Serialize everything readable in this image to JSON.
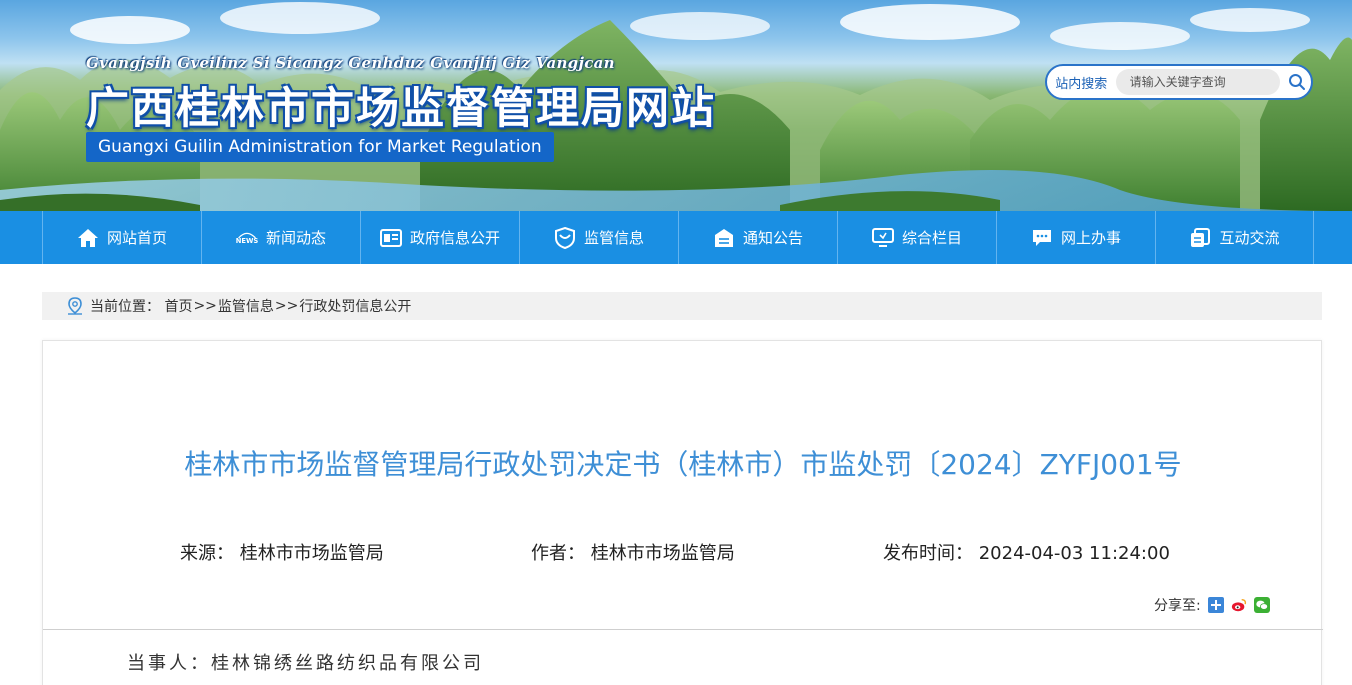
{
  "header": {
    "title_pinyin": "Gvangjsih Gveilinz Si Sicangz Genhduz Gvanjlij Giz Vangjcan",
    "title_cn": "广西桂林市市场监督管理局网站",
    "title_en": "Guangxi Guilin Administration for Market Regulation",
    "search": {
      "label": "站内搜索",
      "placeholder": "请输入关键字查询",
      "icon": "search-icon"
    }
  },
  "nav": {
    "items": [
      {
        "label": "网站首页",
        "icon": "home-icon"
      },
      {
        "label": "新闻动态",
        "icon": "news-icon"
      },
      {
        "label": "政府信息公开",
        "icon": "gov-info-icon"
      },
      {
        "label": "监管信息",
        "icon": "shield-icon"
      },
      {
        "label": "通知公告",
        "icon": "notice-icon"
      },
      {
        "label": "综合栏目",
        "icon": "monitor-icon"
      },
      {
        "label": "网上办事",
        "icon": "chat-icon"
      },
      {
        "label": "互动交流",
        "icon": "copy-icon"
      }
    ]
  },
  "breadcrumb": {
    "prefix": "当前位置：",
    "items": [
      "首页",
      "监管信息",
      "行政处罚信息公开"
    ],
    "separator": ">>"
  },
  "article": {
    "title": "桂林市市场监督管理局行政处罚决定书（桂林市）市监处罚〔2024〕ZYFJ001号",
    "source": "来源： 桂林市市场监管局",
    "author": "作者： 桂林市市场监管局",
    "published": "发布时间： 2024-04-03 11:24:00",
    "share_label": "分享至:",
    "party": "当事人：桂林锦绣丝路纺织品有限公司"
  },
  "colors": {
    "nav_bg": "#1a8fe3",
    "title_blue": "#3e8fd6",
    "banner_en_bg": "#1466c8"
  }
}
